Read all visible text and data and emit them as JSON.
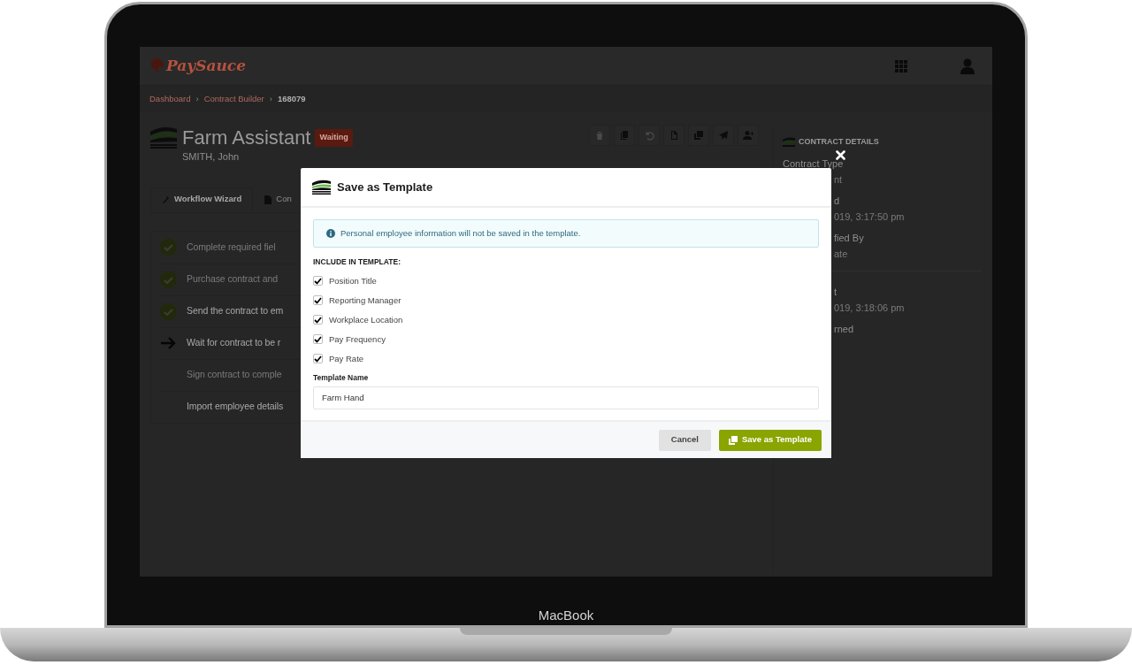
{
  "device": {
    "label": "MacBook"
  },
  "app": {
    "logo": "PaySauce"
  },
  "breadcrumbs": [
    {
      "label": "Dashboard",
      "current": false,
      "separator": "›"
    },
    {
      "label": "Contract Builder",
      "current": false,
      "separator": "›"
    },
    {
      "label": "168079",
      "current": true
    }
  ],
  "contract": {
    "title": "Farm Assistant",
    "status": "Waiting",
    "employee": "SMITH, John"
  },
  "toolbar": [
    {
      "kind": "trash",
      "disabled": true
    },
    {
      "kind": "copy",
      "disabled": false
    },
    {
      "kind": "undo",
      "disabled": true
    },
    {
      "kind": "file",
      "disabled": false
    },
    {
      "kind": "copies",
      "disabled": false
    },
    {
      "kind": "send",
      "disabled": false
    },
    {
      "kind": "user-plus",
      "disabled": false
    }
  ],
  "tabs": [
    {
      "label": "Workflow Wizard",
      "selected": true
    },
    {
      "label": "Con",
      "selected": false
    }
  ],
  "steps": [
    {
      "kind": "done",
      "label": "Complete required fiel",
      "muted": true
    },
    {
      "kind": "done",
      "label": "Purchase contract and",
      "muted": true
    },
    {
      "kind": "done",
      "label": "Send the contract to em",
      "muted": false
    },
    {
      "kind": "current",
      "label": "Wait for contract to be r",
      "muted": false
    },
    {
      "kind": "pending",
      "label": "Sign contract to comple",
      "muted": true
    },
    {
      "kind": "pending",
      "label": "Import employee details",
      "muted": false
    }
  ],
  "details": {
    "title": "CONTRACT DETAILS",
    "heading": "Contract Type",
    "sections": [
      [
        {
          "kind": "value",
          "text": "nt"
        },
        {
          "kind": "label",
          "text": "d"
        },
        {
          "kind": "value",
          "text": "019, 3:17:50 pm"
        },
        {
          "kind": "label",
          "text": "fied By"
        },
        {
          "kind": "value",
          "text": "ate"
        }
      ],
      [
        {
          "kind": "label",
          "text": "t"
        },
        {
          "kind": "value",
          "text": "019, 3:18:06 pm"
        },
        {
          "kind": "label",
          "text": "rned"
        }
      ]
    ]
  },
  "modal": {
    "title": "Save as Template",
    "notice": "Personal employee information will not be saved in the template.",
    "include_label": "INCLUDE IN TEMPLATE:",
    "options": [
      {
        "label": "Position Title",
        "checked": true
      },
      {
        "label": "Reporting Manager",
        "checked": true
      },
      {
        "label": "Workplace Location",
        "checked": true
      },
      {
        "label": "Pay Frequency",
        "checked": true
      },
      {
        "label": "Pay Rate",
        "checked": true
      }
    ],
    "name_label": "Template Name",
    "name_value": "Farm Hand",
    "buttons": [
      {
        "kind": "secondary",
        "label": "Cancel"
      },
      {
        "kind": "primary",
        "label": "Save as Template"
      }
    ]
  }
}
